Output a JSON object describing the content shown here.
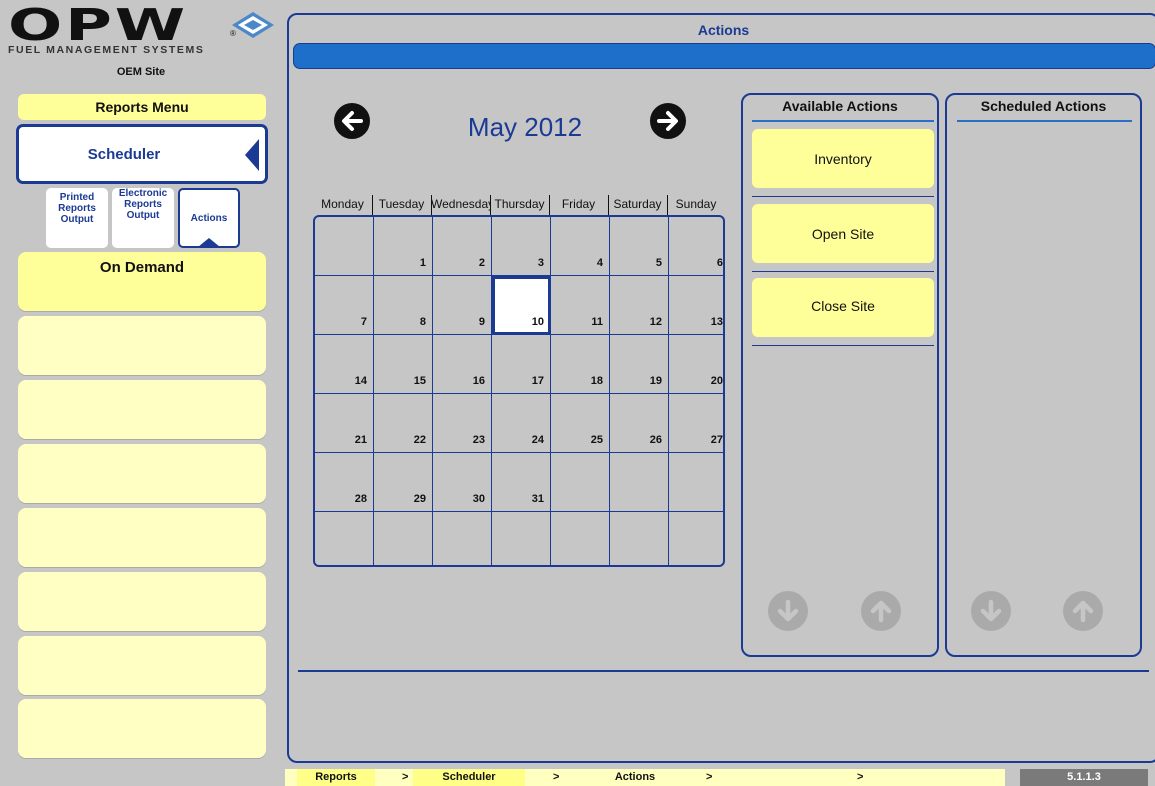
{
  "logo": {
    "word": "OPW",
    "reg": "®",
    "subtitle": "FUEL MANAGEMENT SYSTEMS"
  },
  "site": "OEM Site",
  "menu": {
    "header": "Reports Menu",
    "selected": "Scheduler",
    "subtabs": [
      {
        "label": "Printed Reports Output"
      },
      {
        "label": "Electronic Reports Output"
      },
      {
        "label": "Actions"
      }
    ],
    "on_demand": "On Demand"
  },
  "main": {
    "title": "Actions",
    "month_label": "May 2012",
    "weekdays": [
      "Monday",
      "Tuesday",
      "Wednesday",
      "Thursday",
      "Friday",
      "Saturday",
      "Sunday"
    ],
    "days": [
      [
        "",
        "1",
        "2",
        "3",
        "4",
        "5",
        "6"
      ],
      [
        "7",
        "8",
        "9",
        "10",
        "11",
        "12",
        "13"
      ],
      [
        "14",
        "15",
        "16",
        "17",
        "18",
        "19",
        "20"
      ],
      [
        "21",
        "22",
        "23",
        "24",
        "25",
        "26",
        "27"
      ],
      [
        "28",
        "29",
        "30",
        "31",
        "",
        "",
        ""
      ],
      [
        "",
        "",
        "",
        "",
        "",
        "",
        ""
      ]
    ],
    "selected_day": "10",
    "available_title": "Available Actions",
    "available": [
      "Inventory",
      "Open Site",
      "Close Site"
    ],
    "scheduled_title": "Scheduled Actions"
  },
  "breadcrumb": {
    "items": [
      "Reports",
      "Scheduler",
      "Actions"
    ],
    "sep": ">"
  },
  "version": "5.1.1.3",
  "colors": {
    "accent": "#1b3a94",
    "bar": "#1e6fc9",
    "yellow": "#ffff99",
    "pale_yellow": "#ffffc4",
    "bg": "#c6c6c6"
  }
}
